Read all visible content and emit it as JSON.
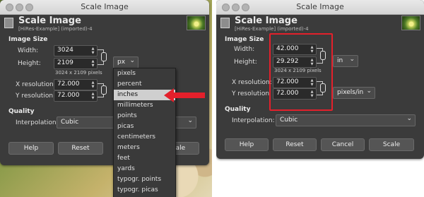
{
  "left_dialog": {
    "window_title": "Scale Image",
    "header_title": "Scale Image",
    "header_subtitle": "[HiRes-Example] (imported)-4",
    "image_size_label": "Image Size",
    "width_label": "Width:",
    "width_value": "3024",
    "height_label": "Height:",
    "height_value": "2109",
    "pixels_note": "3024 x 2109 pixels",
    "unit_selected": "px",
    "xres_label": "X resolution:",
    "xres_value": "72.000",
    "yres_label": "Y resolution:",
    "yres_value": "72.000",
    "quality_label": "Quality",
    "interpolation_label": "Interpolation:",
    "interpolation_value": "Cubic",
    "buttons": {
      "help": "Help",
      "reset": "Reset",
      "scale": "Scale"
    },
    "unit_menu": [
      "pixels",
      "percent",
      "inches",
      "millimeters",
      "points",
      "picas",
      "centimeters",
      "meters",
      "feet",
      "yards",
      "typogr. points",
      "typogr. picas"
    ],
    "highlighted_unit": "inches"
  },
  "right_dialog": {
    "window_title": "Scale Image",
    "header_title": "Scale Image",
    "header_subtitle": "[HiRes-Example] (imported)-4",
    "image_size_label": "Image Size",
    "width_label": "Width:",
    "width_value": "42.000",
    "height_label": "Height:",
    "height_value": "29.292",
    "pixels_note": "3024 x 2109 pixels",
    "unit_selected": "in",
    "xres_label": "X resolution:",
    "xres_value": "72.000",
    "yres_label": "Y resolution:",
    "yres_value": "72.000",
    "res_unit": "pixels/in",
    "quality_label": "Quality",
    "interpolation_label": "Interpolation:",
    "interpolation_value": "Cubic",
    "buttons": {
      "help": "Help",
      "reset": "Reset",
      "cancel": "Cancel",
      "scale": "Scale"
    }
  },
  "colors": {
    "annotation_red": "#e3202b",
    "dialog_bg": "#3b3b3b",
    "menu_highlight": "#cfcfcf"
  },
  "icons": [
    "chain-link-icon",
    "dropdown-caret-icon",
    "spinner-arrows-icon",
    "image-thumbnail-icon",
    "red-arrow-icon"
  ]
}
